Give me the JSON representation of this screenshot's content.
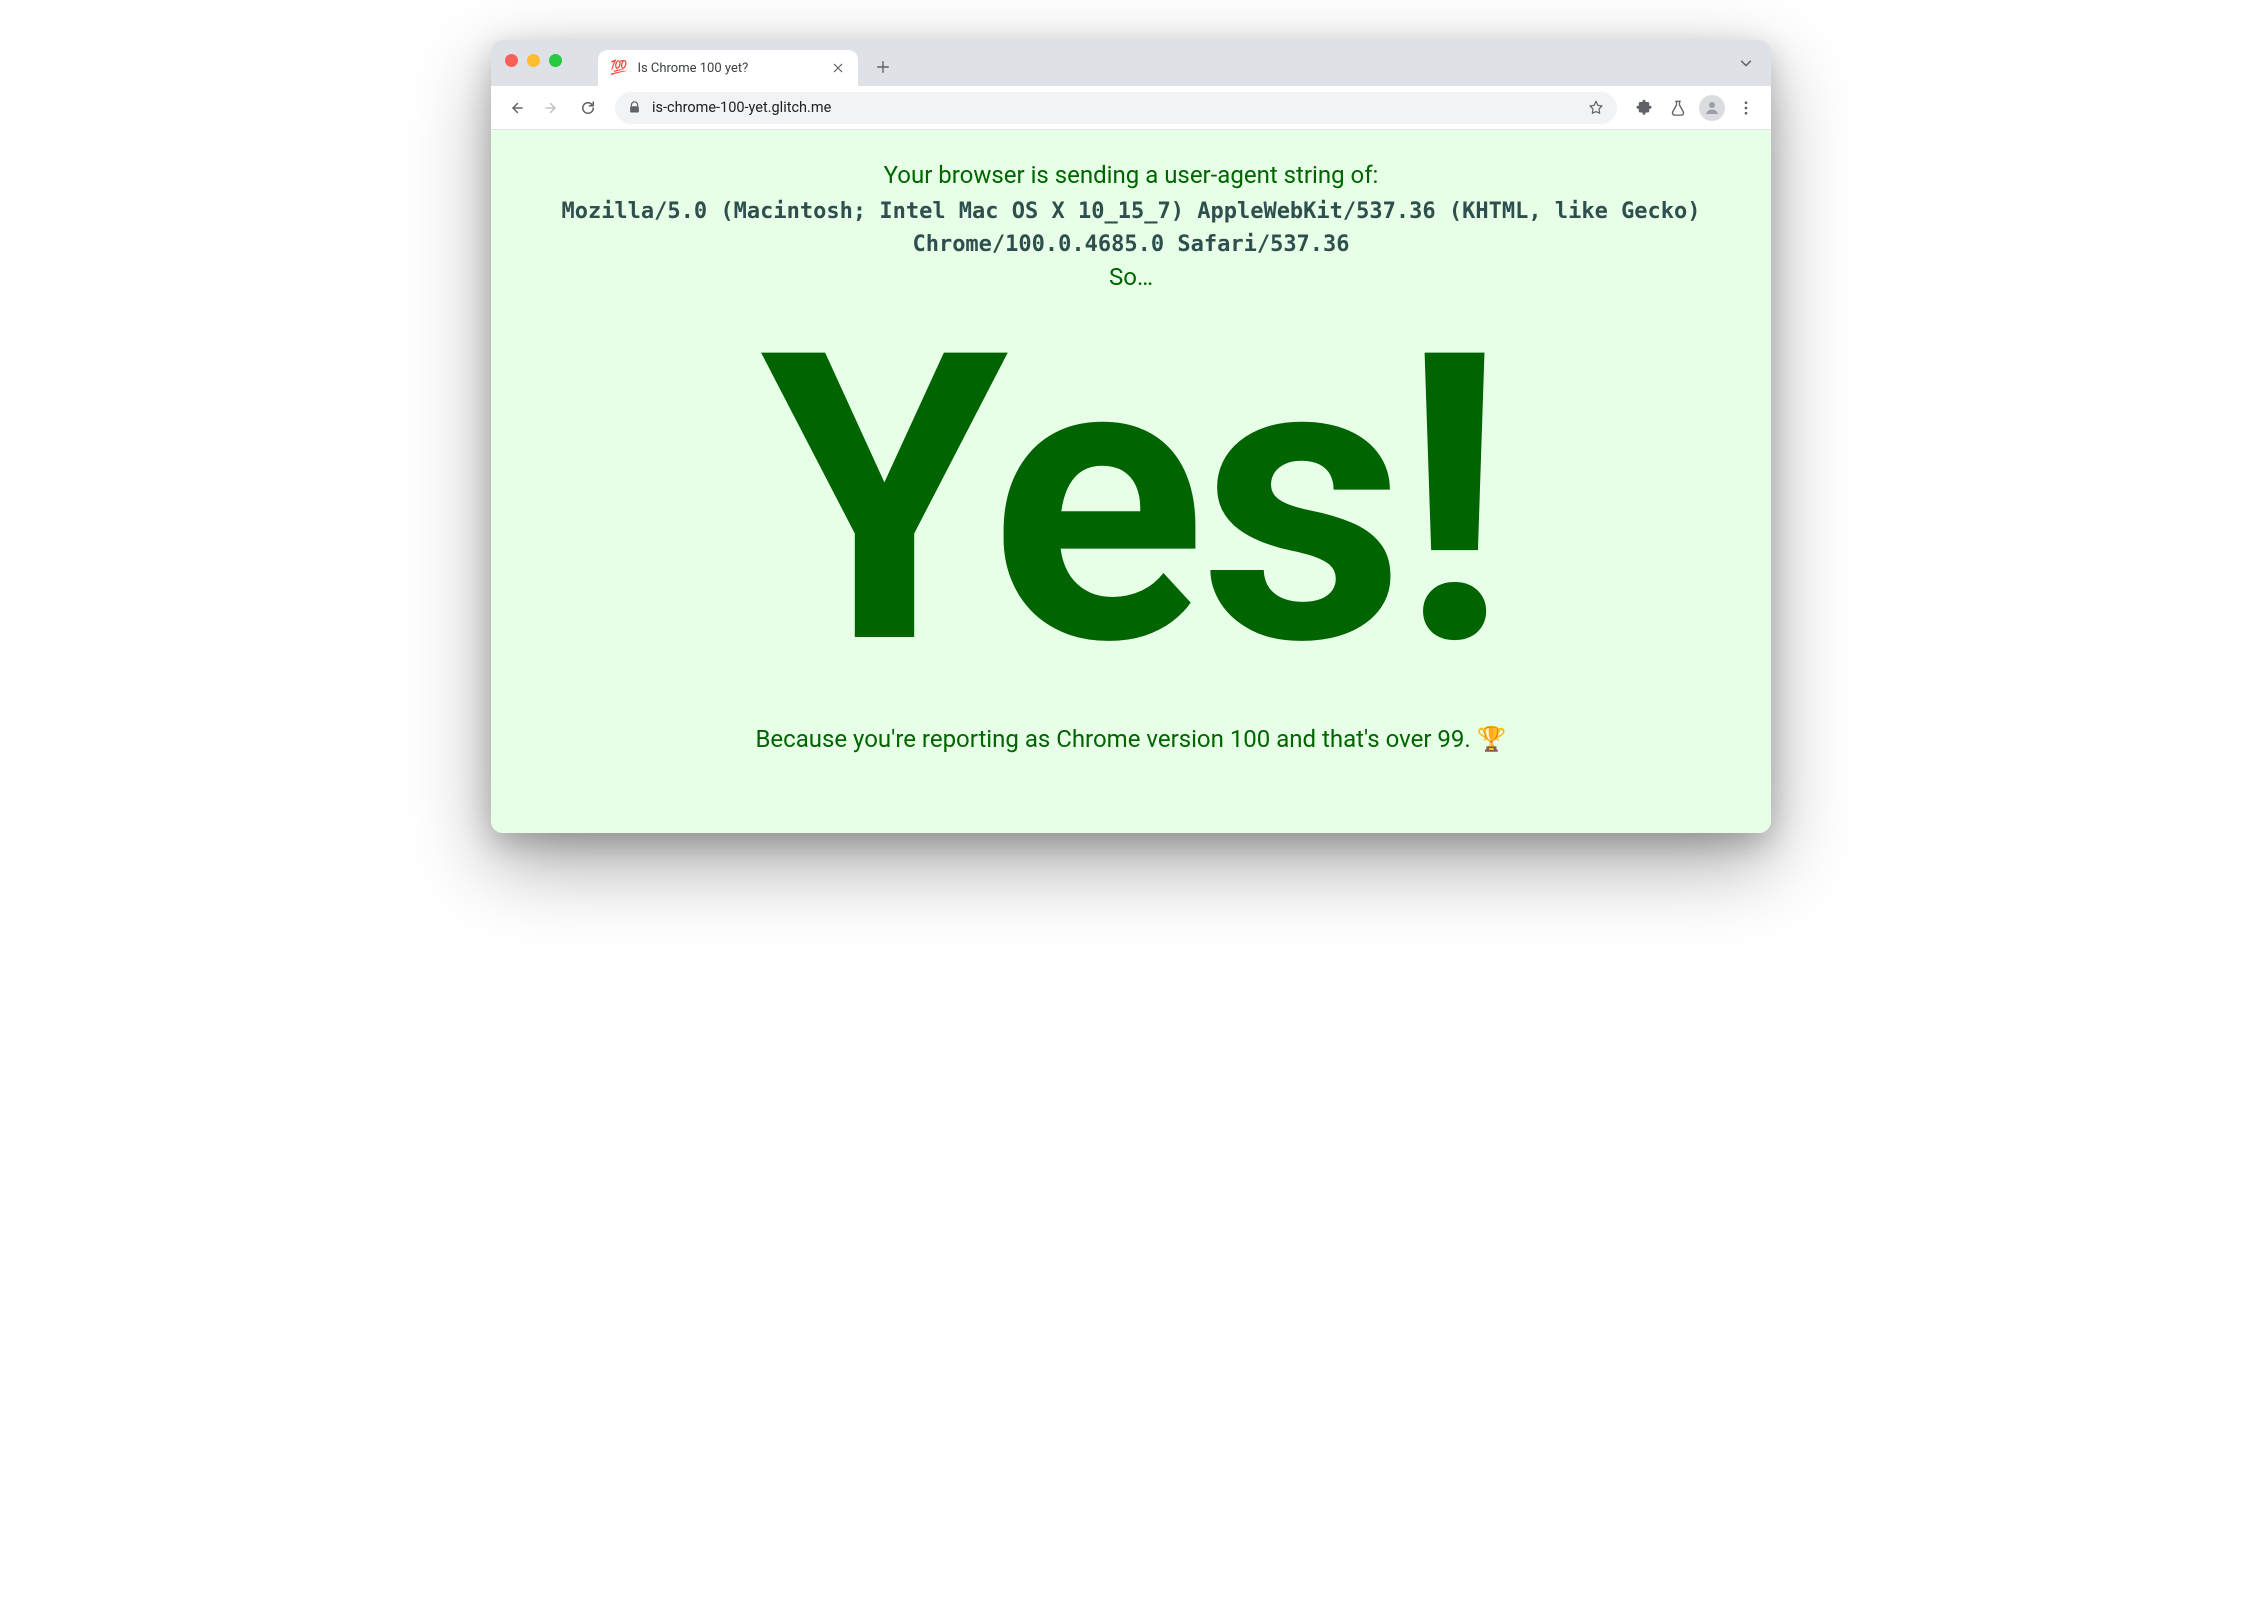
{
  "window": {
    "tab": {
      "favicon": "💯",
      "title": "Is Chrome 100 yet?"
    }
  },
  "toolbar": {
    "url": "is-chrome-100-yet.glitch.me"
  },
  "page": {
    "intro": "Your browser is sending a user-agent string of:",
    "user_agent": "Mozilla/5.0 (Macintosh; Intel Mac OS X 10_15_7) AppleWebKit/537.36 (KHTML, like Gecko) Chrome/100.0.4685.0 Safari/537.36",
    "so": "So…",
    "answer": "Yes!",
    "because": "Because you're reporting as Chrome version 100 and that's over 99. 🏆"
  }
}
